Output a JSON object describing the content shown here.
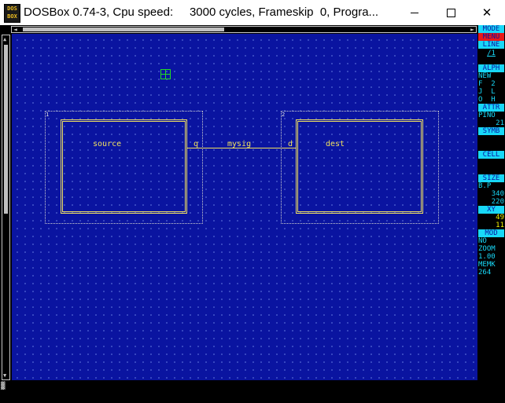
{
  "window": {
    "icon_text_top": "DOS",
    "icon_text_bottom": "BOX",
    "title": "DOSBox 0.74-3, Cpu speed:     3000 cycles, Frameskip  0, Progra...",
    "minimize_symbol": "",
    "close_symbol": "✕"
  },
  "scrollbars": {
    "left_arrow": "◄",
    "right_arrow": "►",
    "up_arrow": "▲",
    "down_arrow": "▼"
  },
  "schematic": {
    "instance_1": {
      "number": "1",
      "name": "source",
      "pin": "q"
    },
    "instance_2": {
      "number": "2",
      "name": "dest",
      "pin": "d"
    },
    "net_name": "mysig"
  },
  "menu": {
    "mode": "MODE",
    "menu": "MENU",
    "line": "LINE",
    "line_value": "/1",
    "alph": "ALPH",
    "new": "NEW",
    "f_row": "F  2",
    "j_row": "J  L",
    "o_row": "O  H",
    "attr": "ATTR",
    "pino": "PINO",
    "pino_value": "21",
    "symb": "SYMB",
    "cell": "CELL",
    "size": "SIZE",
    "bp": "B.P",
    "size_x": "340",
    "size_y": "220",
    "xy": "XY",
    "xy_x": "49",
    "xy_y": "11",
    "mod": "MOD",
    "mod_value": "NO",
    "zoom": "ZOOM",
    "zoom_value": "1.00",
    "memk": "MEMK",
    "memk_value": "264"
  },
  "status": {
    "glyph": "▓"
  },
  "colors": {
    "canvas": "#0a14a0",
    "grid_dot": "#7088e8",
    "symbol": "#f0e060",
    "menu_header": "#18d8f8",
    "menu_selected": "#e81818",
    "cursor": "#22dd22"
  }
}
